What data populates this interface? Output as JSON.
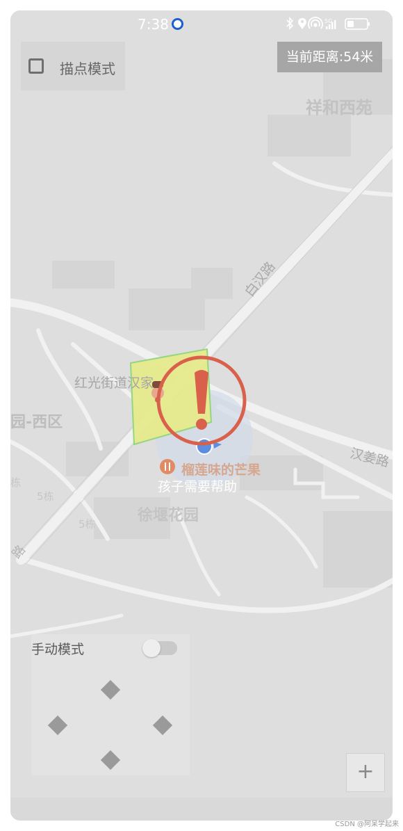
{
  "status_bar": {
    "time": "7:38",
    "network": "5G",
    "icons": [
      "bluetooth-icon",
      "location-icon",
      "hotspot-icon",
      "signal-icon",
      "battery-icon"
    ]
  },
  "draw_mode": {
    "label": "描点模式",
    "checked": false
  },
  "distance": {
    "text": "当前距离:54米"
  },
  "map": {
    "labels": {
      "xianghe": "祥和西苑",
      "baihan_road": "白汉路",
      "hongguang": "红光街道汉家",
      "yuan_xiqu": "园-西区",
      "hanjiang_road": "汉姜路",
      "durian": "榴莲味的芒果",
      "xuyan": "徐堰花园",
      "building_5a": "5栋",
      "building_5b": "5栋",
      "road_left": "路",
      "road_left2": "栋"
    },
    "alert_caption": "孩子需要帮助"
  },
  "manual_mode": {
    "label": "手动模式",
    "enabled": false
  },
  "zoom": {
    "in_label": "+"
  },
  "watermark": "CSDN @阿呆学起来",
  "colors": {
    "alert_red": "#d9614c",
    "geofence_fill": "#e6ea8c",
    "geofence_stroke": "#8fd67a",
    "location_blue": "#5b8ee0"
  }
}
